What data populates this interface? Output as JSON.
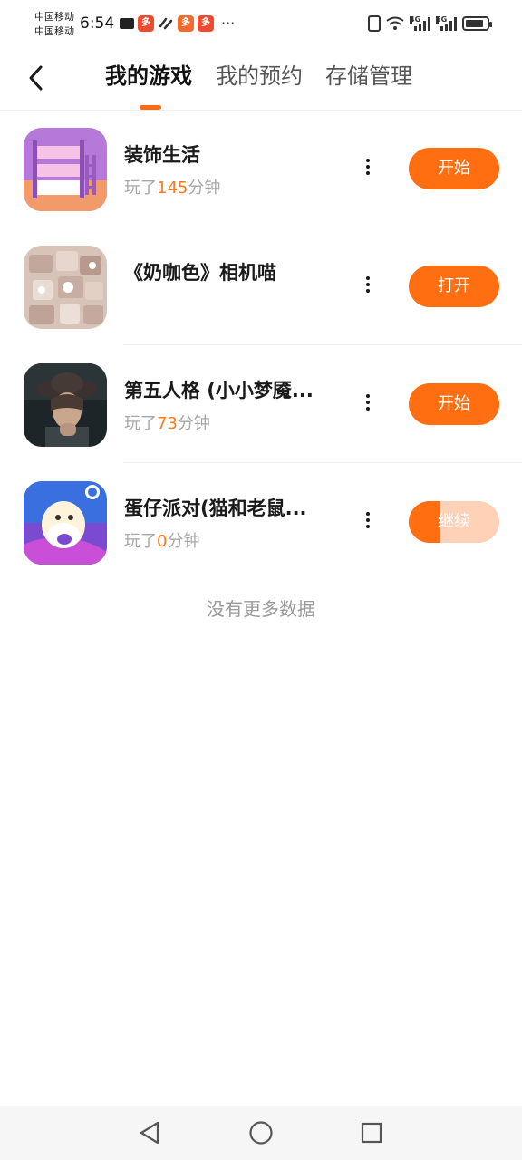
{
  "status_bar": {
    "carrier_1": "中国移动",
    "carrier_2": "中国移动",
    "time": "6:54",
    "network_1": "4G",
    "network_2": "5G",
    "more": "···"
  },
  "header": {
    "tabs": [
      {
        "label": "我的游戏",
        "active": true
      },
      {
        "label": "我的预约",
        "active": false
      },
      {
        "label": "存储管理",
        "active": false
      }
    ]
  },
  "games": [
    {
      "title": "装饰生活",
      "played_prefix": "玩了",
      "played_minutes": "145",
      "played_suffix": "分钟",
      "action": "开始"
    },
    {
      "title": "《奶咖色》相机喵",
      "played_prefix": "",
      "played_minutes": "",
      "played_suffix": "",
      "action": "打开"
    },
    {
      "title": "第五人格 (小小梦魇...",
      "played_prefix": "玩了",
      "played_minutes": "73",
      "played_suffix": "分钟",
      "action": "开始"
    },
    {
      "title": "蛋仔派对(猫和老鼠...",
      "played_prefix": "玩了",
      "played_minutes": "0",
      "played_suffix": "分钟",
      "action": "继续",
      "progress": 0.35
    }
  ],
  "footer_text": "没有更多数据",
  "colors": {
    "accent": "#ff6f12",
    "played_number": "#ff7a1a"
  }
}
